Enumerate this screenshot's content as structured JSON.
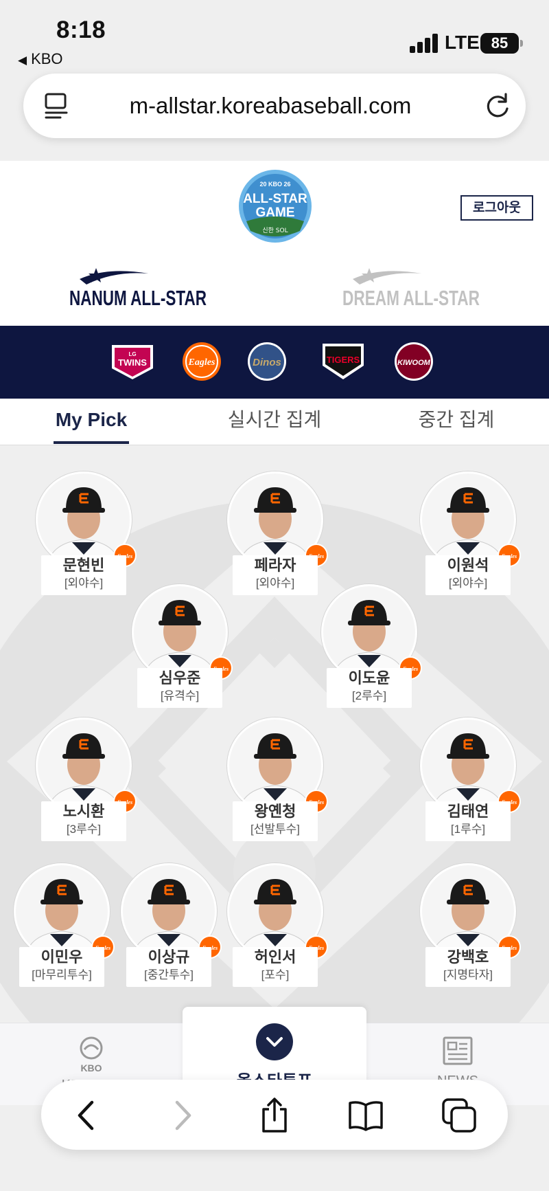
{
  "status_bar": {
    "time": "8:18",
    "back_app": "KBO",
    "network": "LTE",
    "battery": "85"
  },
  "browser": {
    "url": "m-allstar.koreabaseball.com"
  },
  "header": {
    "logout_label": "로그아웃",
    "allstar_logo_top": "20 KBO 26",
    "allstar_logo_main1": "ALL-STAR",
    "allstar_logo_main2": "GAME",
    "allstar_logo_sponsor": "신한 SOL",
    "nanum_label": "NANUM ALL-STAR",
    "dream_label": "DREAM ALL-STAR"
  },
  "teams": [
    {
      "name": "TWINS",
      "sub": "LG",
      "color": "#c30452"
    },
    {
      "name": "Eagles",
      "color": "#ff6600"
    },
    {
      "name": "Dinos",
      "color": "#315288"
    },
    {
      "name": "TIGERS",
      "color": "#ea0029"
    },
    {
      "name": "KIWOOM",
      "color": "#820024"
    }
  ],
  "tabs": {
    "my_pick": "My Pick",
    "realtime": "실시간 집계",
    "interim": "중간 집계"
  },
  "players": [
    {
      "name": "문현빈",
      "position": "[외야수]"
    },
    {
      "name": "페라자",
      "position": "[외야수]"
    },
    {
      "name": "이원석",
      "position": "[외야수]"
    },
    {
      "name": "심우준",
      "position": "[유격수]"
    },
    {
      "name": "이도윤",
      "position": "[2루수]"
    },
    {
      "name": "노시환",
      "position": "[3루수]"
    },
    {
      "name": "왕옌청",
      "position": "[선발투수]"
    },
    {
      "name": "김태연",
      "position": "[1루수]"
    },
    {
      "name": "이민우",
      "position": "[마무리투수]"
    },
    {
      "name": "이상규",
      "position": "[중간투수]"
    },
    {
      "name": "허인서",
      "position": "[포수]"
    },
    {
      "name": "강백호",
      "position": "[지명타자]"
    }
  ],
  "team_emblem": "Eagles",
  "bottom_nav": {
    "kbo_app": "KBO APP",
    "kbo_logo_text": "KBO",
    "vote": "올스타투표",
    "news": "NEWS"
  },
  "colors": {
    "navy": "#1b2549",
    "team_bar": "#0e1640",
    "eagles_orange": "#ff6600",
    "scribble": "#2fb4f0"
  }
}
